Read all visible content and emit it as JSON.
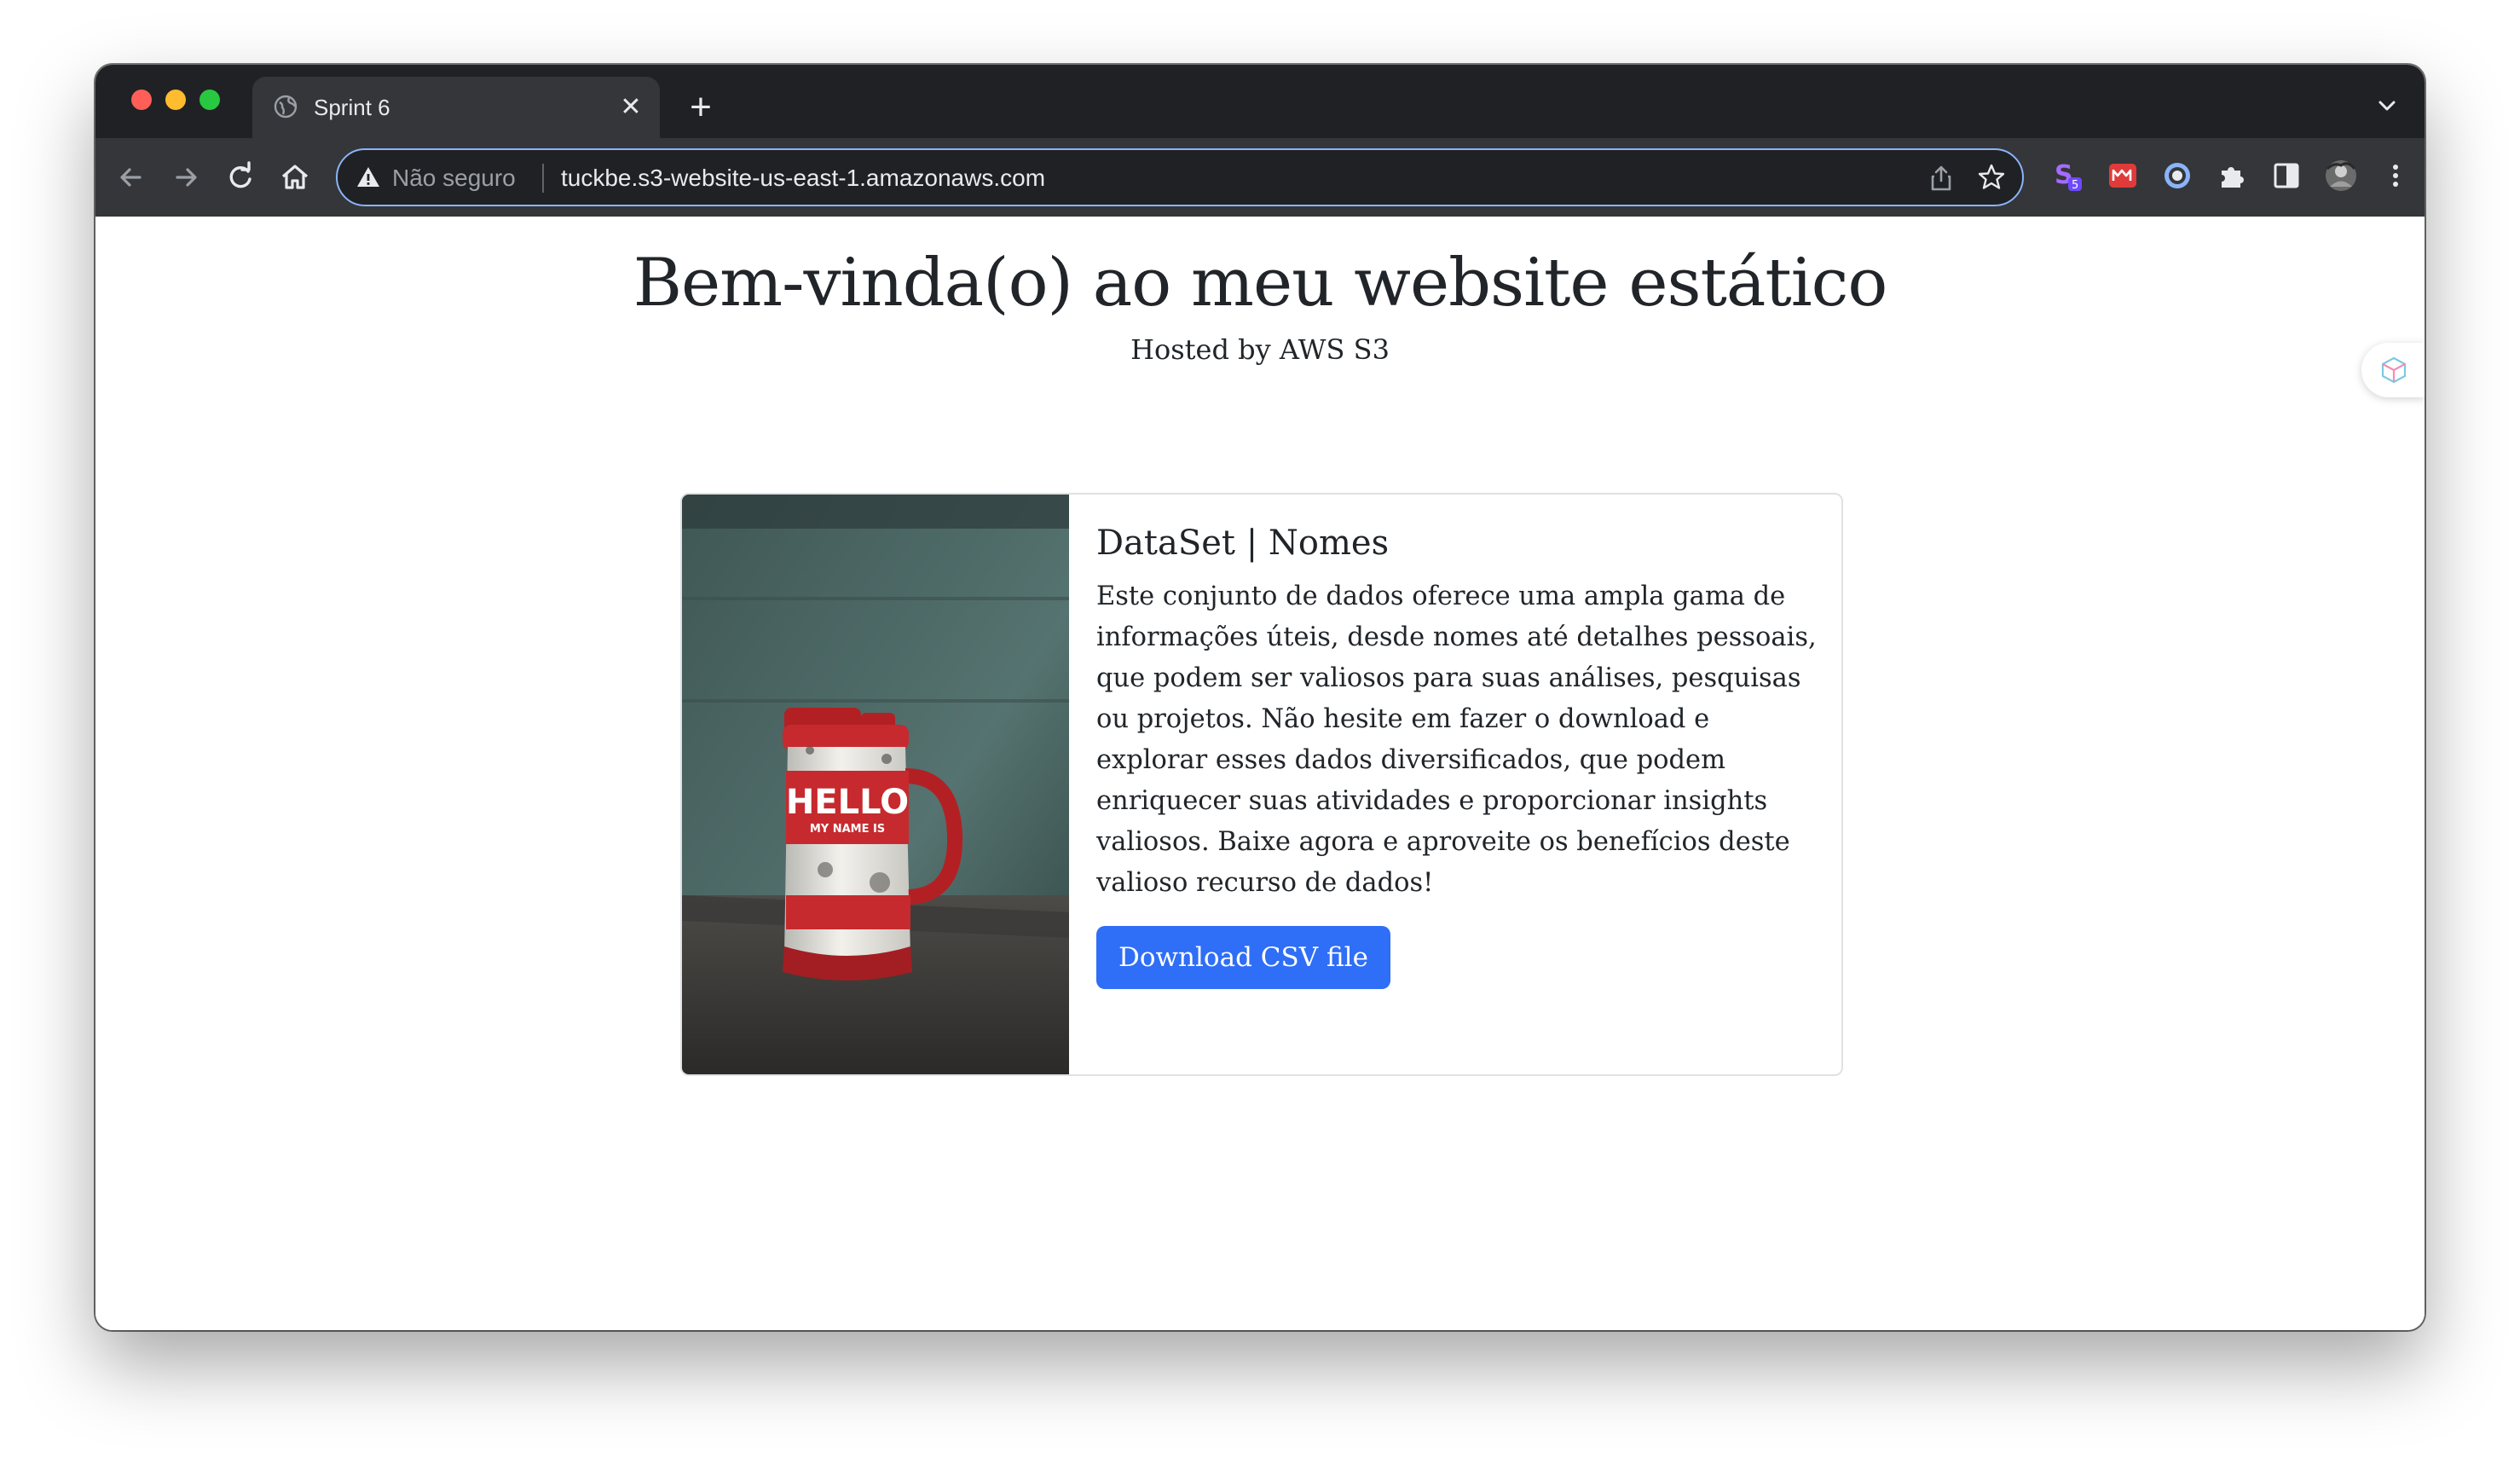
{
  "browser": {
    "tab": {
      "title": "Sprint 6",
      "close_glyph": "✕",
      "favicon": "globe-icon"
    },
    "new_tab_glyph": "+",
    "omnibox": {
      "security_label": "Não seguro",
      "url": "tuckbe.s3-website-us-east-1.amazonaws.com"
    },
    "extensions": [
      "s-extension-icon",
      "red-extension-icon",
      "circle-extension-icon",
      "puzzle-icon",
      "side-panel-icon",
      "profile-avatar"
    ],
    "extension_badge": "5"
  },
  "page": {
    "title": "Bem-vinda(o) ao meu website estático",
    "subtitle": "Hosted by AWS S3",
    "card": {
      "title": "DataSet | Nomes",
      "text": "Este conjunto de dados oferece uma ampla gama de informações úteis, desde nomes até detalhes pessoais, que podem ser valiosos para suas análises, pesquisas ou projetos. Não hesite em fazer o download e explorar esses dados diversificados, que podem enriquecer suas atividades e proporcionar insights valiosos. Baixe agora e aproveite os benefícios deste valioso recurso de dados!",
      "button_label": "Download CSV file",
      "image": {
        "description_icon": "hello-my-name-is-thermos-image",
        "label_big": "HELLO",
        "label_small": "MY NAME IS"
      }
    }
  },
  "colors": {
    "chrome_dark": "#202124",
    "chrome_toolbar": "#35363a",
    "button_blue": "#2f6ef6",
    "text_dark": "#212529"
  }
}
